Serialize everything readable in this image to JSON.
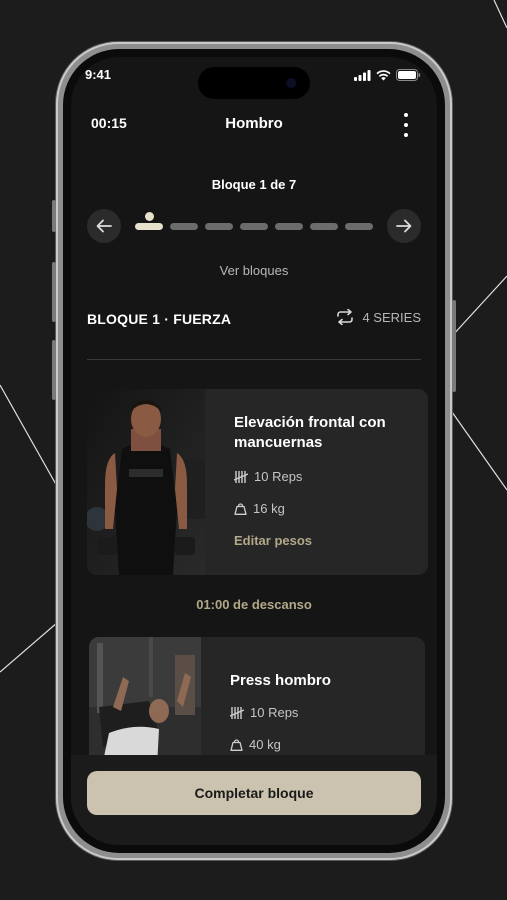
{
  "status_bar": {
    "time": "9:41"
  },
  "header": {
    "timer": "00:15",
    "title": "Hombro"
  },
  "block_nav": {
    "label": "Bloque 1 de 7",
    "total_blocks": 7,
    "current_block": 1,
    "view_blocks_label": "Ver bloques"
  },
  "section": {
    "title": "BLOQUE 1 · FUERZA",
    "series_label": "4 SERIES"
  },
  "exercises": [
    {
      "name": "Elevación frontal con mancuernas",
      "reps": "10 Reps",
      "weight": "16 kg",
      "edit_label": "Editar pesos"
    },
    {
      "name": "Press hombro",
      "reps": "10 Reps",
      "weight": "40 kg"
    }
  ],
  "rest": {
    "label": "01:00 de descanso"
  },
  "cta": {
    "label": "Completar bloque"
  },
  "colors": {
    "accent": "#b2a889",
    "button": "#cbc3af",
    "card": "#262626",
    "background": "#151515"
  }
}
